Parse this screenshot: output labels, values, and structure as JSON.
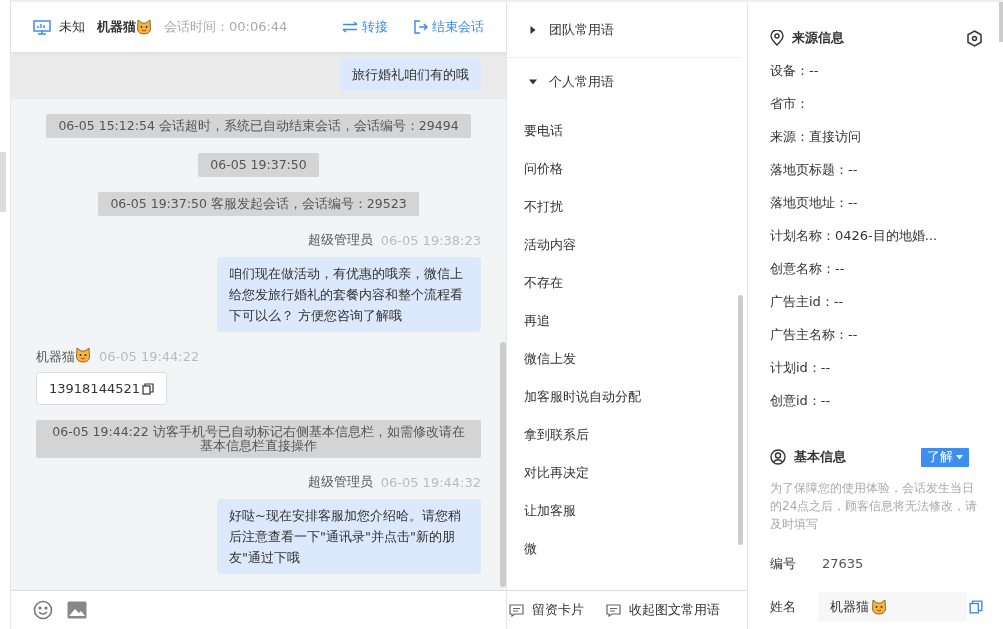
{
  "chat_header": {
    "device": "未知",
    "visitor_name": "机器猫",
    "session_time": "会话时间：00:06:44",
    "actions": [
      {
        "kind": "transfer",
        "label": "转接"
      },
      {
        "kind": "end",
        "label": "结束会话"
      }
    ]
  },
  "messages": [
    {
      "kind": "agent",
      "faded": true,
      "text": "旅行婚礼咱们有的哦"
    },
    {
      "kind": "system",
      "text": "06-05 15:12:54 会话超时，系统已自动结束会话，会话编号：29494"
    },
    {
      "kind": "system",
      "text": "06-05 19:37:50"
    },
    {
      "kind": "system",
      "text": "06-05 19:37:50 客服发起会话，会话编号：29523"
    },
    {
      "kind": "agent",
      "faded": false,
      "sender": "超级管理员",
      "time": "06-05 19:38:23",
      "text": "咱们现在做活动，有优惠的哦亲，微信上给您发旅行婚礼的套餐内容和整个流程看下可以么？ 方便您咨询了解哦"
    },
    {
      "kind": "visitor",
      "sender": "机器猫",
      "time": "06-05 19:44:22",
      "text": "13918144521"
    },
    {
      "kind": "system",
      "text": "06-05 19:44:22 访客手机号已自动标记右侧基本信息栏，如需修改请在基本信息栏直接操作"
    },
    {
      "kind": "agent",
      "faded": false,
      "sender": "超级管理员",
      "time": "06-05 19:44:32",
      "text": "好哒~现在安排客服加您介绍哈。请您稍后注意查看一下\"通讯录\"并点击\"新的朋友\"通过下哦"
    }
  ],
  "phrase_groups": [
    {
      "title": "团队常用语",
      "expanded": false
    },
    {
      "title": "个人常用语",
      "expanded": true,
      "items": [
        "要电话",
        "问价格",
        "不打扰",
        "活动内容",
        "不存在",
        "再追",
        "微信上发",
        "加客服时说自动分配",
        "拿到联系后",
        "对比再决定",
        "让加客服",
        "微"
      ]
    }
  ],
  "phrase_footer": [
    "留资卡片",
    "收起图文常用语"
  ],
  "source_info": {
    "title": "来源信息",
    "fields": [
      "设备：--",
      "省市：",
      "来源：直接访问",
      "落地页标题：--",
      "落地页地址：--",
      "计划名称：0426-目的地婚...",
      "创意名称：--",
      "广告主id：--",
      "广告主名称：--",
      "计划id：--",
      "创意id：--"
    ]
  },
  "basic_info": {
    "title": "基本信息",
    "button": "了解",
    "note": "为了保障您的使用体验，会话发生当日的24点之后，顾客信息将无法修改，请及时填写",
    "id_label": "编号",
    "id_value": "27635",
    "name_label": "姓名",
    "name_value": "机器猫"
  }
}
